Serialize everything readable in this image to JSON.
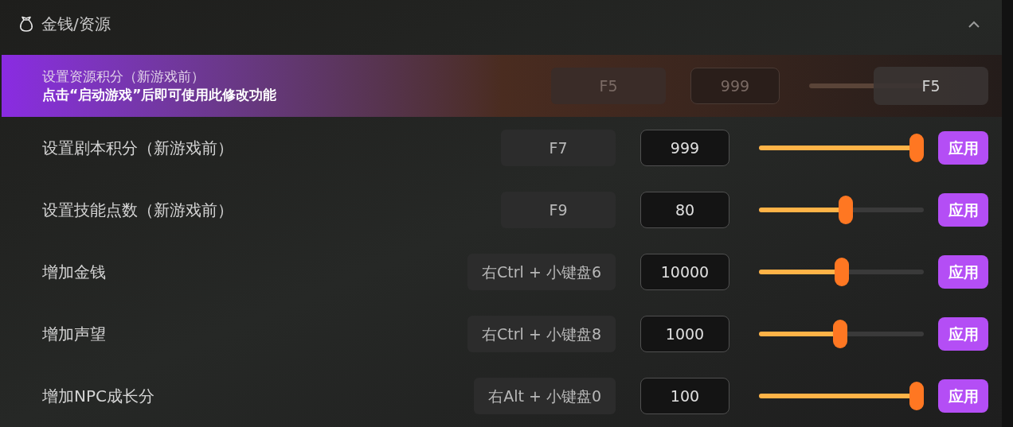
{
  "section": {
    "title": "金钱/资源",
    "expanded": true
  },
  "rows": [
    {
      "label": "设置资源积分（新游戏前）",
      "hotkey": "F5",
      "value": "999",
      "locked": true,
      "notice": "点击“启动游戏”后即可使用此修改功能",
      "overlay_key": "F5"
    },
    {
      "label": "设置剧本积分（新游戏前）",
      "hotkey": "F7",
      "value": "999",
      "level": 1,
      "locked": false,
      "button": "应用"
    },
    {
      "label": "设置技能点数（新游戏前）",
      "hotkey": "F9",
      "value": "80",
      "level": 0.53,
      "locked": false,
      "button": "应用"
    },
    {
      "label": "增加金钱",
      "hotkey": "右Ctrl + 小键盘6",
      "value": "10000",
      "level": 0.5,
      "locked": false,
      "button": "应用"
    },
    {
      "label": "增加声望",
      "hotkey": "右Ctrl + 小键盘8",
      "value": "1000",
      "level": 0.49,
      "locked": false,
      "button": "应用"
    },
    {
      "label": "增加NPC成长分",
      "hotkey": "右Alt + 小键盘0",
      "value": "100",
      "level": 1,
      "locked": false,
      "button": "应用"
    }
  ]
}
